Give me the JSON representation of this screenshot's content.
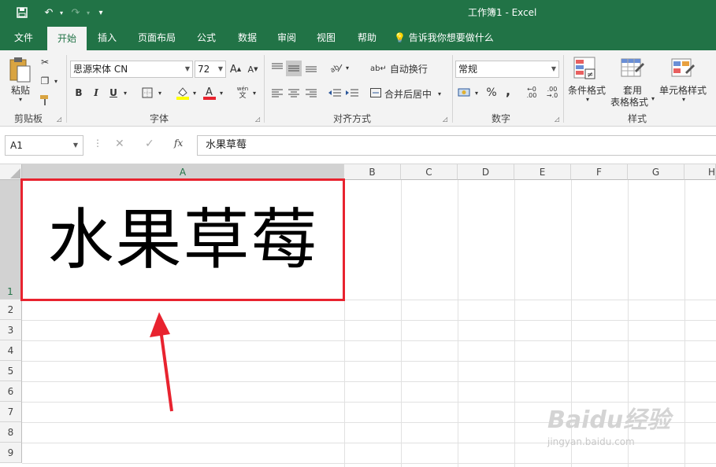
{
  "titlebar": {
    "title": "工作簿1  -   Excel"
  },
  "tabs": [
    {
      "label": "文件"
    },
    {
      "label": "开始"
    },
    {
      "label": "插入"
    },
    {
      "label": "页面布局"
    },
    {
      "label": "公式"
    },
    {
      "label": "数据"
    },
    {
      "label": "审阅"
    },
    {
      "label": "视图"
    },
    {
      "label": "帮助"
    },
    {
      "label": "告诉我你想要做什么"
    }
  ],
  "ribbon": {
    "clipboard": {
      "paste_label": "粘贴",
      "group_label": "剪贴板"
    },
    "font": {
      "font_name": "思源宋体 CN",
      "font_size": "72",
      "group_label": "字体",
      "bold": "B",
      "italic": "I",
      "underline": "U"
    },
    "alignment": {
      "wrap_text": "自动换行",
      "merge_center": "合并后居中",
      "group_label": "对齐方式"
    },
    "number": {
      "format": "常规",
      "percent": "%",
      "comma": ",",
      "group_label": "数字"
    },
    "styles": {
      "conditional": "条件格式",
      "table_format_line1": "套用",
      "table_format_line2": "表格格式",
      "cell_styles": "单元格样式",
      "group_label": "样式"
    }
  },
  "formula_bar": {
    "name_box": "A1",
    "fx": "fx",
    "content": "水果草莓"
  },
  "grid": {
    "columns": [
      "A",
      "B",
      "C",
      "D",
      "E",
      "F",
      "G",
      "H"
    ],
    "rows": [
      "1",
      "2",
      "3",
      "4",
      "5",
      "6",
      "7",
      "8",
      "9"
    ],
    "cell_A1": "水果草莓"
  },
  "colors": {
    "excel_green": "#217346",
    "highlight_red": "#e8232f"
  },
  "watermark": {
    "brand": "Baidu经验",
    "url": "jingyan.baidu.com"
  }
}
